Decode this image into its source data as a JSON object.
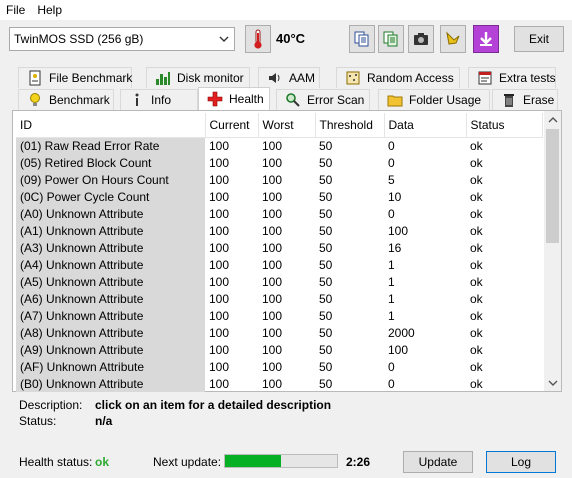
{
  "menu": {
    "file": "File",
    "help": "Help"
  },
  "toolbar": {
    "drive": "TwinMOS SSD (256 gB)",
    "temperature": "40°C",
    "exit_label": "Exit",
    "icons": [
      "copy-text-icon",
      "copy-clipboard-icon",
      "camera-icon",
      "save-icon",
      "download-icon"
    ]
  },
  "tabs_row1": [
    "File Benchmark",
    "Disk monitor",
    "AAM",
    "Random Access",
    "Extra tests"
  ],
  "tabs_row2": [
    "Benchmark",
    "Info",
    "Health",
    "Error Scan",
    "Folder Usage",
    "Erase"
  ],
  "active_tab": "Health",
  "table": {
    "headers": [
      "ID",
      "Current",
      "Worst",
      "Threshold",
      "Data",
      "Status"
    ],
    "rows": [
      [
        "(01) Raw Read Error Rate",
        "100",
        "100",
        "50",
        "0",
        "ok"
      ],
      [
        "(05) Retired Block Count",
        "100",
        "100",
        "50",
        "0",
        "ok"
      ],
      [
        "(09) Power On Hours Count",
        "100",
        "100",
        "50",
        "5",
        "ok"
      ],
      [
        "(0C) Power Cycle Count",
        "100",
        "100",
        "50",
        "10",
        "ok"
      ],
      [
        "(A0) Unknown Attribute",
        "100",
        "100",
        "50",
        "0",
        "ok"
      ],
      [
        "(A1) Unknown Attribute",
        "100",
        "100",
        "50",
        "100",
        "ok"
      ],
      [
        "(A3) Unknown Attribute",
        "100",
        "100",
        "50",
        "16",
        "ok"
      ],
      [
        "(A4) Unknown Attribute",
        "100",
        "100",
        "50",
        "1",
        "ok"
      ],
      [
        "(A5) Unknown Attribute",
        "100",
        "100",
        "50",
        "1",
        "ok"
      ],
      [
        "(A6) Unknown Attribute",
        "100",
        "100",
        "50",
        "1",
        "ok"
      ],
      [
        "(A7) Unknown Attribute",
        "100",
        "100",
        "50",
        "1",
        "ok"
      ],
      [
        "(A8) Unknown Attribute",
        "100",
        "100",
        "50",
        "2000",
        "ok"
      ],
      [
        "(A9) Unknown Attribute",
        "100",
        "100",
        "50",
        "100",
        "ok"
      ],
      [
        "(AF) Unknown Attribute",
        "100",
        "100",
        "50",
        "0",
        "ok"
      ],
      [
        "(B0) Unknown Attribute",
        "100",
        "100",
        "50",
        "0",
        "ok"
      ]
    ]
  },
  "description": {
    "label": "Description:",
    "value": "click on an item for a detailed description",
    "status_label": "Status:",
    "status_value": "n/a"
  },
  "status": {
    "health_label": "Health status:",
    "health_value": "ok",
    "next_update_label": "Next update:",
    "next_update_time": "2:26",
    "progress_fraction": 0.5,
    "update_button": "Update",
    "log_button": "Log"
  },
  "colors": {
    "ok_green": "#2eaa2e",
    "progress_green": "#06b025",
    "purple_button": "#b442d6"
  }
}
